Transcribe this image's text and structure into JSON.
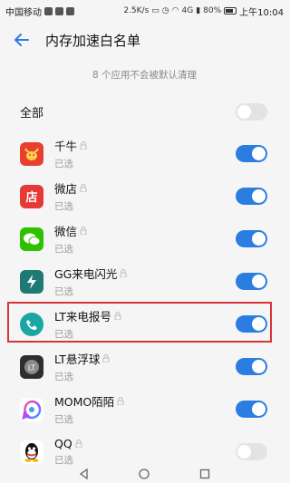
{
  "status": {
    "carrier": "中国移动",
    "speed": "2.5K/s",
    "network": "4G",
    "battery": "80%",
    "time": "上午10:04"
  },
  "header": {
    "title": "内存加速白名单"
  },
  "subtitle": "8 个应用不会被默认清理",
  "all": {
    "label": "全部",
    "on": false
  },
  "apps": [
    {
      "name": "千牛",
      "sub": "已选",
      "on": true,
      "icon": "qianniu-icon",
      "color": "#e8402f"
    },
    {
      "name": "微店",
      "sub": "已选",
      "on": true,
      "icon": "weidian-icon",
      "color": "#e53935"
    },
    {
      "name": "微信",
      "sub": "已选",
      "on": true,
      "icon": "wechat-icon",
      "color": "#2dc100"
    },
    {
      "name": "GG来电闪光",
      "sub": "已选",
      "on": true,
      "icon": "flash-icon",
      "color": "#1f7a73"
    },
    {
      "name": "LT来电报号",
      "sub": "已选",
      "on": true,
      "icon": "lt-call-icon",
      "color": "#1aa6a2"
    },
    {
      "name": "LT悬浮球",
      "sub": "已选",
      "on": true,
      "icon": "lt-float-icon",
      "color": "#333333"
    },
    {
      "name": "MOMO陌陌",
      "sub": "已选",
      "on": true,
      "icon": "momo-icon",
      "color": "#ffffff"
    },
    {
      "name": "QQ",
      "sub": "已选",
      "on": false,
      "icon": "qq-icon",
      "color": "#ffffff"
    }
  ]
}
